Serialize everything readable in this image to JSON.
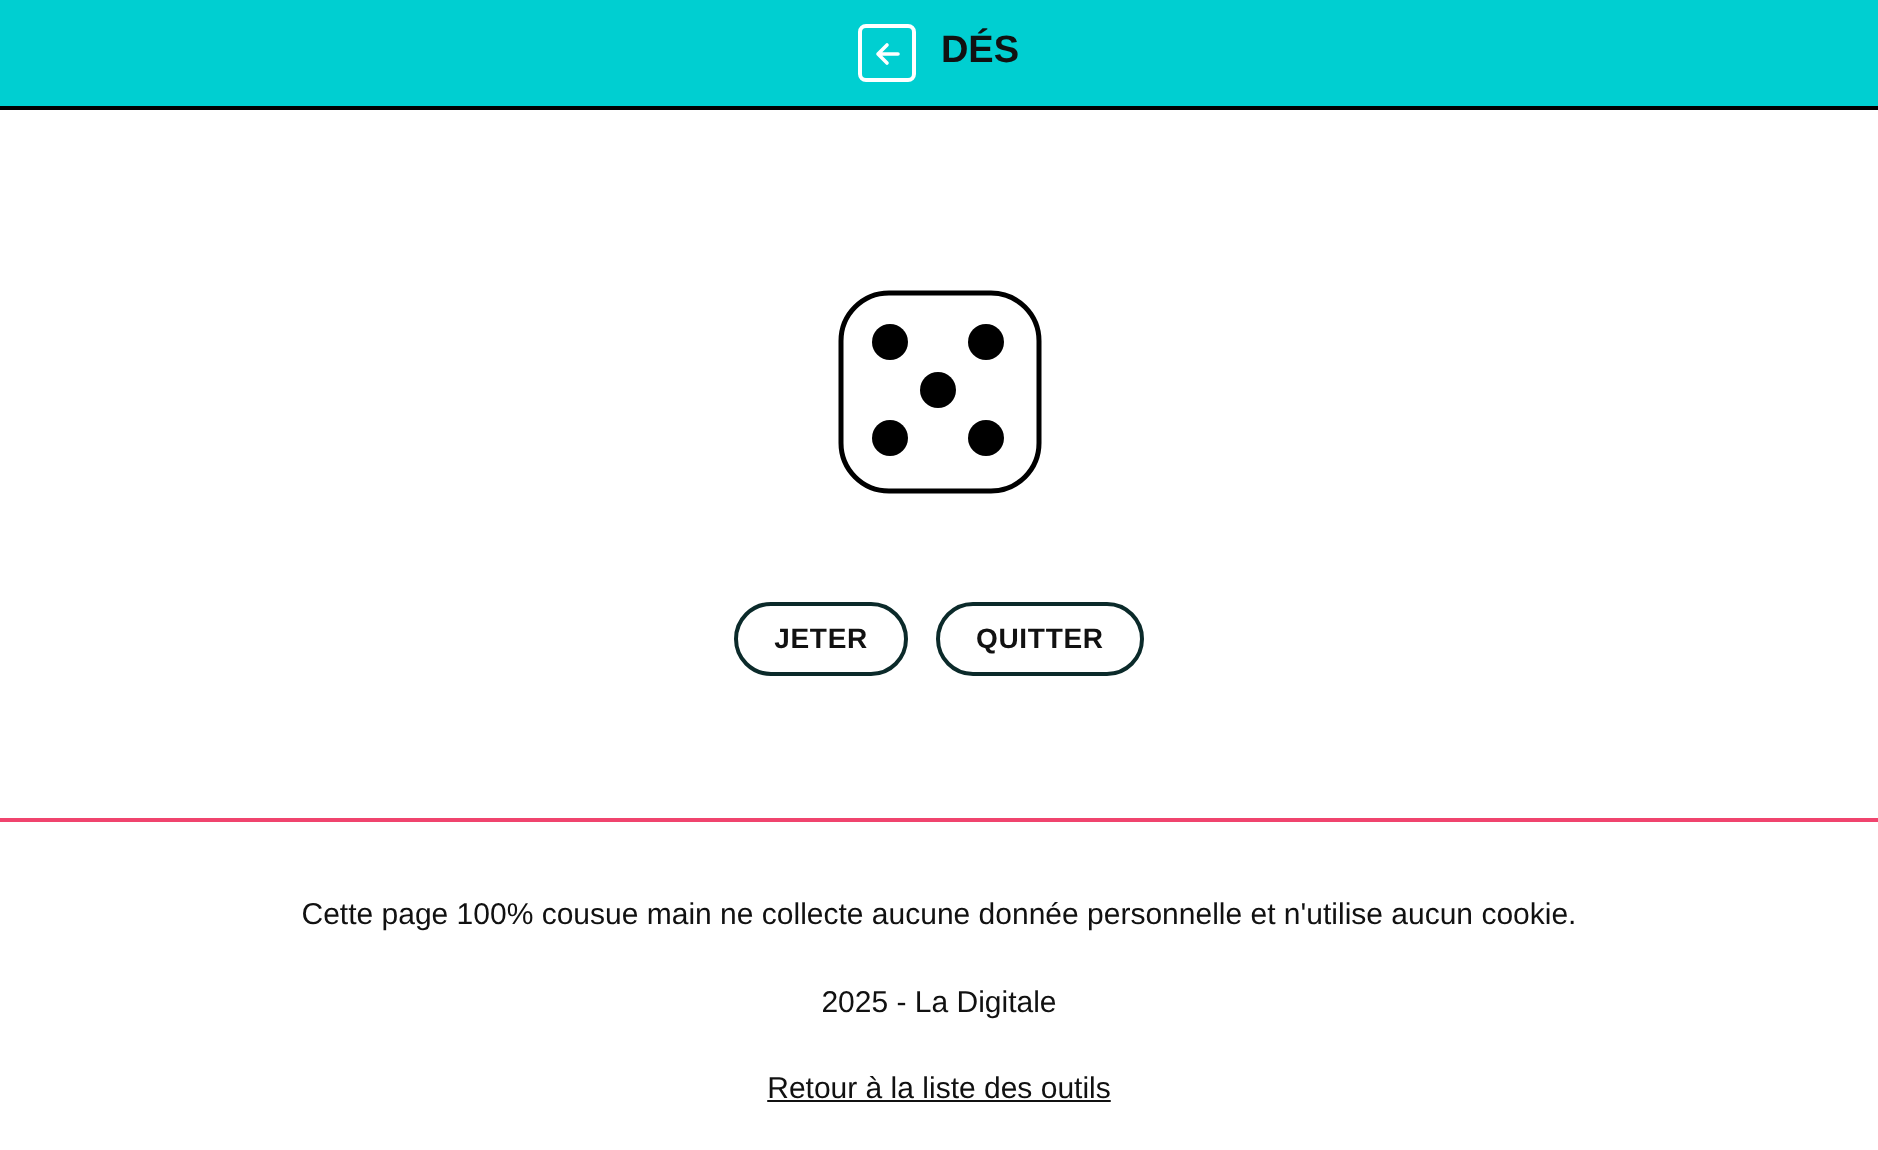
{
  "header": {
    "title": "DÉS"
  },
  "die": {
    "kind": "five"
  },
  "buttons": [
    "JETER",
    "QUITTER"
  ],
  "footer": {
    "notice": "Cette page 100% cousue main ne collecte aucune donnée personnelle et n'utilise aucun cookie.",
    "credit": "2025 - La Digitale",
    "link": "Retour à la liste des outils"
  }
}
